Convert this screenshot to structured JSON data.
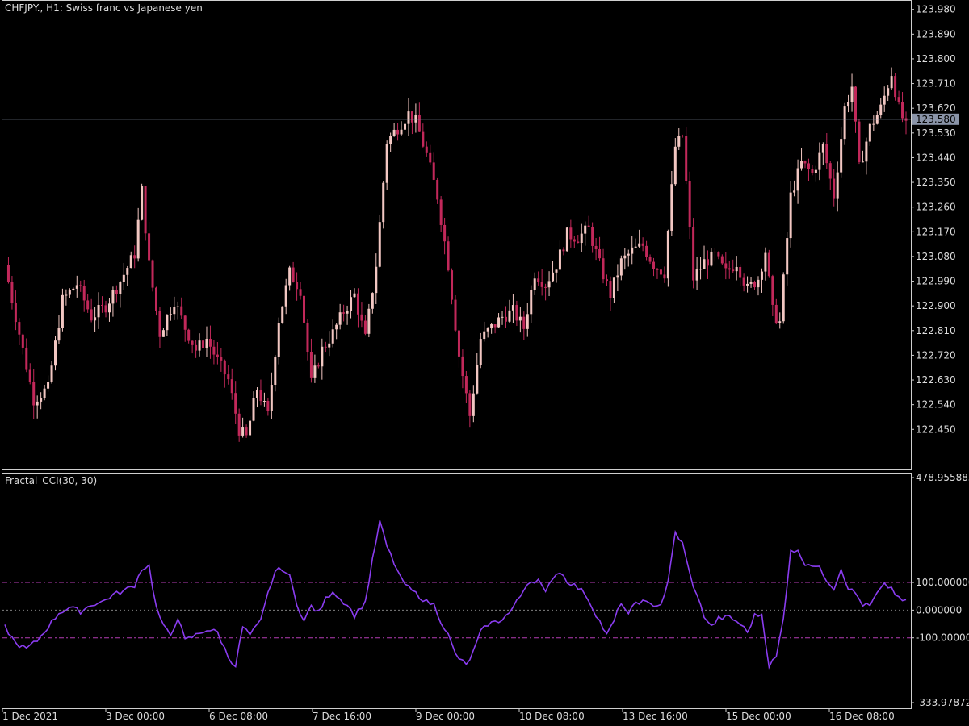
{
  "header": {
    "title": "CHFJPY., H1:  Swiss franc vs Japanese yen",
    "indicator_title": "Fractal_CCI(30, 30)"
  },
  "colors": {
    "background": "#000000",
    "frame": "#cfcfcf",
    "bull_candle": "#f2c7c2",
    "bear_candle": "#c2285a",
    "cci_line": "#8a3cf0",
    "level_line": "#b43cb4",
    "zero_line": "#808080",
    "price_tag": "#8a94a8"
  },
  "chart_data": [
    {
      "type": "candlestick",
      "symbol": "CHFJPY.",
      "timeframe": "H1",
      "description": "Swiss franc vs Japanese yen",
      "y_ticks": [
        "123.980",
        "123.890",
        "123.800",
        "123.710",
        "123.620",
        "123.530",
        "123.440",
        "123.350",
        "123.260",
        "123.170",
        "123.080",
        "122.990",
        "122.900",
        "122.810",
        "122.720",
        "122.630",
        "122.540",
        "122.450"
      ],
      "ylim": [
        122.395,
        123.985
      ],
      "current_price": "123.580",
      "x_ticks": [
        "1 Dec 2021",
        "3 Dec 00:00",
        "6 Dec 08:00",
        "7 Dec 16:00",
        "9 Dec 00:00",
        "10 Dec 08:00",
        "13 Dec 16:00",
        "15 Dec 00:00",
        "16 Dec 08:00"
      ],
      "close_path": [
        [
          0,
          123.05
        ],
        [
          4,
          122.8
        ],
        [
          8,
          122.56
        ],
        [
          12,
          122.6
        ],
        [
          16,
          122.92
        ],
        [
          20,
          122.98
        ],
        [
          24,
          122.86
        ],
        [
          28,
          122.9
        ],
        [
          32,
          122.99
        ],
        [
          36,
          123.09
        ],
        [
          38,
          123.32
        ],
        [
          40,
          123.05
        ],
        [
          43,
          122.8
        ],
        [
          47,
          122.92
        ],
        [
          50,
          122.82
        ],
        [
          53,
          122.74
        ],
        [
          56,
          122.78
        ],
        [
          59,
          122.7
        ],
        [
          62,
          122.63
        ],
        [
          65,
          122.45
        ],
        [
          67,
          122.42
        ],
        [
          70,
          122.6
        ],
        [
          73,
          122.5
        ],
        [
          76,
          122.85
        ],
        [
          79,
          123.02
        ],
        [
          82,
          122.96
        ],
        [
          85,
          122.62
        ],
        [
          88,
          122.74
        ],
        [
          91,
          122.8
        ],
        [
          94,
          122.88
        ],
        [
          97,
          122.94
        ],
        [
          100,
          122.78
        ],
        [
          103,
          123.05
        ],
        [
          106,
          123.5
        ],
        [
          109,
          123.55
        ],
        [
          112,
          123.6
        ],
        [
          114,
          123.57
        ],
        [
          117,
          123.45
        ],
        [
          120,
          123.3
        ],
        [
          123,
          123.05
        ],
        [
          126,
          122.72
        ],
        [
          129,
          122.5
        ],
        [
          132,
          122.78
        ],
        [
          135,
          122.82
        ],
        [
          138,
          122.86
        ],
        [
          141,
          122.88
        ],
        [
          144,
          122.82
        ],
        [
          147,
          123.02
        ],
        [
          150,
          122.98
        ],
        [
          153,
          123.05
        ],
        [
          156,
          123.16
        ],
        [
          159,
          123.15
        ],
        [
          162,
          123.18
        ],
        [
          165,
          123.05
        ],
        [
          168,
          122.94
        ],
        [
          171,
          123.06
        ],
        [
          174,
          123.1
        ],
        [
          177,
          123.12
        ],
        [
          180,
          123.05
        ],
        [
          183,
          123.02
        ],
        [
          186,
          123.48
        ],
        [
          188,
          123.52
        ],
        [
          191,
          123.0
        ],
        [
          194,
          123.06
        ],
        [
          197,
          123.08
        ],
        [
          200,
          123.02
        ],
        [
          203,
          123.06
        ],
        [
          206,
          122.96
        ],
        [
          209,
          123.0
        ],
        [
          211,
          123.1
        ],
        [
          213,
          122.88
        ],
        [
          215,
          122.84
        ],
        [
          218,
          123.3
        ],
        [
          221,
          123.42
        ],
        [
          224,
          123.38
        ],
        [
          227,
          123.48
        ],
        [
          230,
          123.3
        ],
        [
          233,
          123.62
        ],
        [
          235,
          123.7
        ],
        [
          237,
          123.4
        ],
        [
          240,
          123.55
        ],
        [
          243,
          123.62
        ],
        [
          246,
          123.75
        ],
        [
          248,
          123.62
        ],
        [
          250,
          123.55
        ]
      ]
    },
    {
      "type": "line",
      "name": "Fractal_CCI(30, 30)",
      "y_ticks": [
        "478.955883",
        "100.000000",
        "0.000000",
        "-100.000000",
        "-333.978727"
      ],
      "ylim": [
        -333.978727,
        478.955883
      ],
      "levels": [
        100,
        0,
        -100
      ],
      "cci_path": [
        [
          0,
          -60
        ],
        [
          3,
          -120
        ],
        [
          6,
          -140
        ],
        [
          9,
          -110
        ],
        [
          12,
          -60
        ],
        [
          15,
          -10
        ],
        [
          18,
          10
        ],
        [
          21,
          -5
        ],
        [
          24,
          20
        ],
        [
          27,
          30
        ],
        [
          30,
          55
        ],
        [
          33,
          70
        ],
        [
          36,
          90
        ],
        [
          38,
          150
        ],
        [
          40,
          160
        ],
        [
          42,
          10
        ],
        [
          44,
          -60
        ],
        [
          46,
          -90
        ],
        [
          48,
          -25
        ],
        [
          50,
          -110
        ],
        [
          53,
          -90
        ],
        [
          56,
          -70
        ],
        [
          59,
          -80
        ],
        [
          62,
          -170
        ],
        [
          64,
          -200
        ],
        [
          66,
          -60
        ],
        [
          68,
          -90
        ],
        [
          71,
          -40
        ],
        [
          73,
          60
        ],
        [
          75,
          140
        ],
        [
          77,
          150
        ],
        [
          79,
          120
        ],
        [
          81,
          25
        ],
        [
          83,
          -40
        ],
        [
          85,
          15
        ],
        [
          87,
          -10
        ],
        [
          89,
          40
        ],
        [
          91,
          70
        ],
        [
          93,
          40
        ],
        [
          95,
          20
        ],
        [
          97,
          -20
        ],
        [
          100,
          30
        ],
        [
          102,
          180
        ],
        [
          104,
          320
        ],
        [
          106,
          230
        ],
        [
          108,
          170
        ],
        [
          110,
          110
        ],
        [
          112,
          80
        ],
        [
          115,
          50
        ],
        [
          117,
          30
        ],
        [
          119,
          20
        ],
        [
          121,
          -40
        ],
        [
          123,
          -90
        ],
        [
          125,
          -160
        ],
        [
          128,
          -200
        ],
        [
          130,
          -150
        ],
        [
          132,
          -80
        ],
        [
          134,
          -50
        ],
        [
          137,
          -40
        ],
        [
          140,
          -10
        ],
        [
          143,
          50
        ],
        [
          145,
          100
        ],
        [
          148,
          110
        ],
        [
          150,
          60
        ],
        [
          152,
          120
        ],
        [
          154,
          140
        ],
        [
          156,
          105
        ],
        [
          158,
          90
        ],
        [
          161,
          60
        ],
        [
          163,
          10
        ],
        [
          165,
          -40
        ],
        [
          167,
          -90
        ],
        [
          169,
          -40
        ],
        [
          171,
          30
        ],
        [
          173,
          -20
        ],
        [
          175,
          30
        ],
        [
          177,
          30
        ],
        [
          179,
          20
        ],
        [
          182,
          20
        ],
        [
          184,
          100
        ],
        [
          186,
          280
        ],
        [
          188,
          240
        ],
        [
          190,
          130
        ],
        [
          192,
          50
        ],
        [
          194,
          -20
        ],
        [
          196,
          -60
        ],
        [
          198,
          -30
        ],
        [
          201,
          -25
        ],
        [
          204,
          -50
        ],
        [
          206,
          -80
        ],
        [
          208,
          -20
        ],
        [
          210,
          -15
        ],
        [
          212,
          -200
        ],
        [
          214,
          -170
        ],
        [
          216,
          -30
        ],
        [
          218,
          220
        ],
        [
          220,
          210
        ],
        [
          222,
          170
        ],
        [
          224,
          165
        ],
        [
          226,
          150
        ],
        [
          228,
          110
        ],
        [
          230,
          80
        ],
        [
          232,
          150
        ],
        [
          234,
          80
        ],
        [
          236,
          60
        ],
        [
          238,
          20
        ],
        [
          240,
          15
        ],
        [
          242,
          60
        ],
        [
          244,
          90
        ],
        [
          246,
          80
        ],
        [
          248,
          40
        ],
        [
          250,
          30
        ]
      ]
    }
  ]
}
